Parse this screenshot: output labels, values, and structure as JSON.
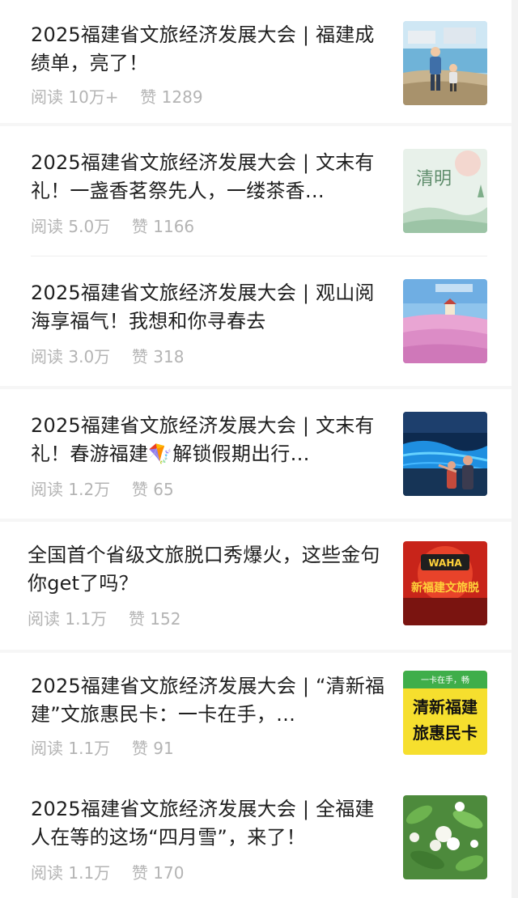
{
  "articles": [
    {
      "title": "2025福建省文旅经济发展大会 | 福建成绩单，亮了！",
      "read_label": "阅读",
      "read_count": "10万+",
      "like_label": "赞",
      "like_count": "1289",
      "thumbnail": "father-and-child-seaside-illustration"
    },
    {
      "title": "2025福建省文旅经济发展大会 | 文末有礼！一盏香茗祭先人，一缕茶香…",
      "read_label": "阅读",
      "read_count": "5.0万",
      "like_label": "赞",
      "like_count": "1166",
      "thumbnail": "qingming-poster",
      "thumbnail_text": "清明"
    },
    {
      "title": "2025福建省文旅经济发展大会 | 观山阅海享福气！我想和你寻春去",
      "read_label": "阅读",
      "read_count": "3.0万",
      "like_label": "赞",
      "like_count": "318",
      "thumbnail": "pink-flower-field-lighthouse"
    },
    {
      "title": "2025福建省文旅经济发展大会 | 文末有礼！春游福建🪁解锁假期出行…",
      "read_label": "阅读",
      "read_count": "1.2万",
      "like_label": "赞",
      "like_count": "65",
      "thumbnail": "blue-tears-beach-couple"
    },
    {
      "title": "全国首个省级文旅脱口秀爆火，这些金句你get了吗？",
      "read_label": "阅读",
      "read_count": "1.1万",
      "like_label": "赞",
      "like_count": "152",
      "thumbnail": "talk-show-stage-poster",
      "thumbnail_text": "新福建文旅脱"
    },
    {
      "title": "2025福建省文旅经济发展大会 | “清新福建”文旅惠民卡：一卡在手，…",
      "read_label": "阅读",
      "read_count": "1.1万",
      "like_label": "赞",
      "like_count": "91",
      "thumbnail": "benefit-card-poster",
      "thumbnail_text_top": "一卡在手，畅",
      "thumbnail_text_line1": "清新福建",
      "thumbnail_text_line2": "旅惠民卡"
    },
    {
      "title": "2025福建省文旅经济发展大会 | 全福建人在等的这场“四月雪”，来了！",
      "read_label": "阅读",
      "read_count": "1.1万",
      "like_label": "赞",
      "like_count": "170",
      "thumbnail": "white-blossom-branches"
    }
  ],
  "colors": {
    "title": "#1f1f1f",
    "meta": "#b4b4b4",
    "background": "#ffffff",
    "divider": "#eeeeee"
  }
}
